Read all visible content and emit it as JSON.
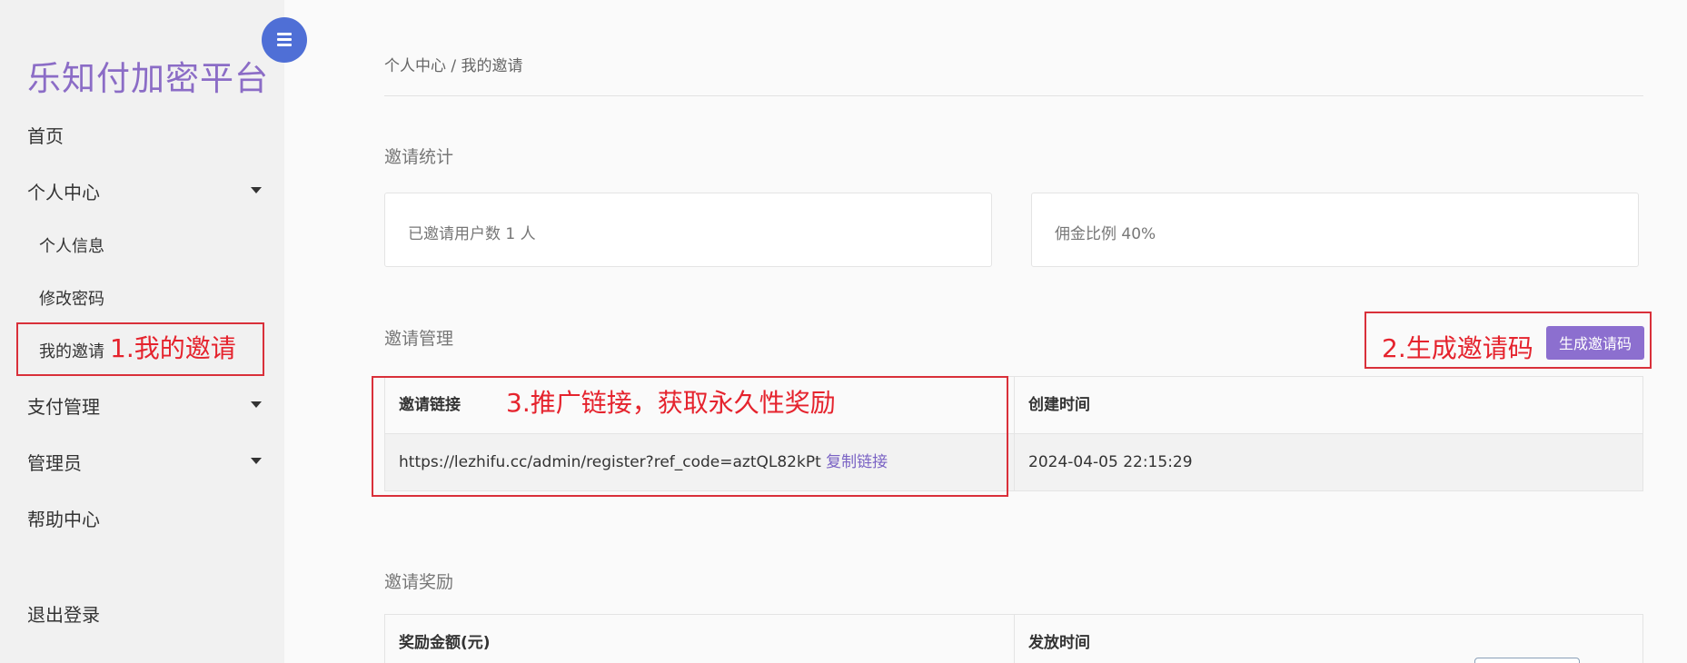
{
  "sidebar": {
    "brand": "乐知付加密平台",
    "items": {
      "home": "首页",
      "personal_center": "个人中心",
      "personal_info": "个人信息",
      "change_password": "修改密码",
      "my_invite": "我的邀请",
      "payment_mgmt": "支付管理",
      "admin": "管理员",
      "help": "帮助中心",
      "logout": "退出登录"
    }
  },
  "annotations": {
    "step1": "1.我的邀请",
    "step2": "2.生成邀请码",
    "step3": "3.推广链接，获取永久性奖励"
  },
  "breadcrumb": "个人中心 / 我的邀请",
  "stats": {
    "title": "邀请统计",
    "invited_users": "已邀请用户数 1 人",
    "commission": "佣金比例 40%"
  },
  "invite_mgmt": {
    "title": "邀请管理",
    "generate_button": "生成邀请码",
    "columns": {
      "link": "邀请链接",
      "created": "创建时间"
    },
    "rows": [
      {
        "link": "https://lezhifu.cc/admin/register?ref_code=aztQL82kPt",
        "copy": "复制链接",
        "created": "2024-04-05 22:15:29"
      }
    ]
  },
  "rewards": {
    "title": "邀请奖励",
    "columns": {
      "amount": "奖励金额(元)",
      "time": "发放时间"
    }
  }
}
